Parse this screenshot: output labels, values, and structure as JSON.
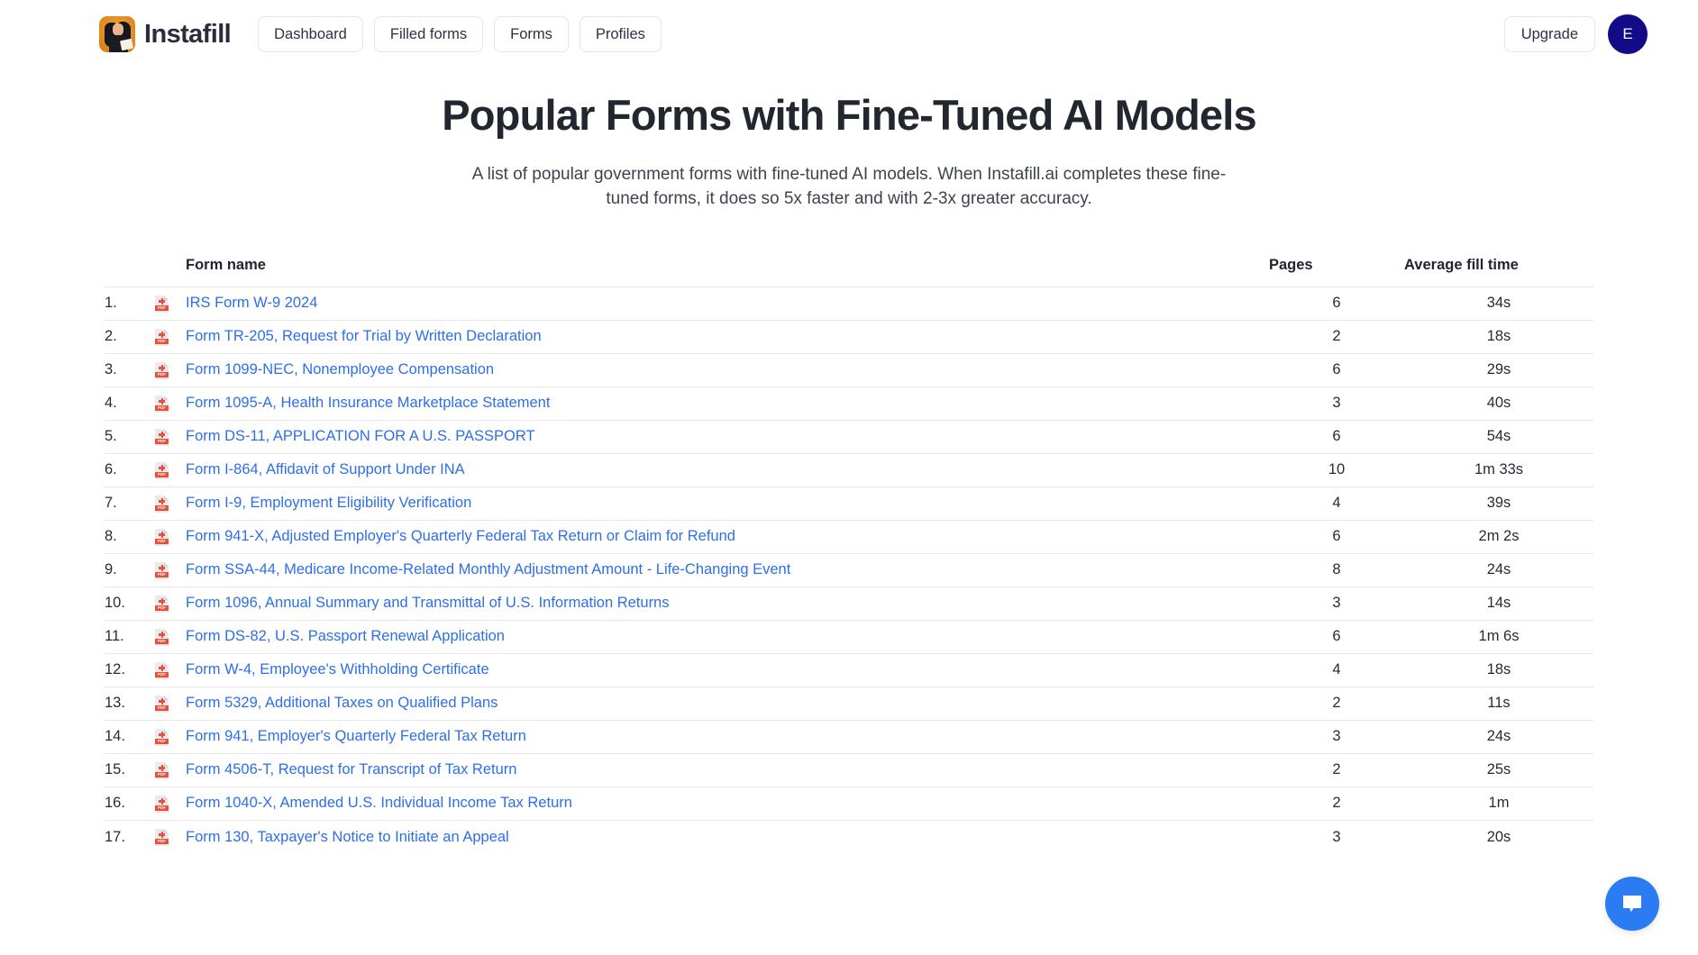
{
  "header": {
    "brand_name": "Instafill",
    "brand_logo_icon": "instafill-avatar-logo",
    "nav": [
      {
        "label": "Dashboard",
        "name": "nav-dashboard"
      },
      {
        "label": "Filled forms",
        "name": "nav-filled-forms"
      },
      {
        "label": "Forms",
        "name": "nav-forms"
      },
      {
        "label": "Profiles",
        "name": "nav-profiles"
      }
    ],
    "upgrade_label": "Upgrade",
    "avatar_initial": "E",
    "avatar_color": "#120a86"
  },
  "main": {
    "title": "Popular Forms with Fine-Tuned AI Models",
    "subtitle": "A list of popular government forms with fine-tuned AI models. When Instafill.ai completes these fine-tuned forms, it does so 5x faster and with 2-3x greater accuracy."
  },
  "table": {
    "columns": {
      "index": "",
      "name": "Form name",
      "pages": "Pages",
      "time": "Average fill time"
    },
    "rows": [
      {
        "index": "1.",
        "icon": "pdf-file-icon",
        "name": "IRS Form W-9 2024",
        "pages": "6",
        "time": "34s"
      },
      {
        "index": "2.",
        "icon": "pdf-file-icon",
        "name": "Form TR-205, Request for Trial by Written Declaration",
        "pages": "2",
        "time": "18s"
      },
      {
        "index": "3.",
        "icon": "pdf-file-icon",
        "name": "Form 1099-NEC, Nonemployee Compensation",
        "pages": "6",
        "time": "29s"
      },
      {
        "index": "4.",
        "icon": "pdf-file-icon",
        "name": "Form 1095-A, Health Insurance Marketplace Statement",
        "pages": "3",
        "time": "40s"
      },
      {
        "index": "5.",
        "icon": "pdf-file-icon",
        "name": "Form DS-11, APPLICATION FOR A U.S. PASSPORT",
        "pages": "6",
        "time": "54s"
      },
      {
        "index": "6.",
        "icon": "pdf-file-icon",
        "name": "Form I-864, Affidavit of Support Under INA",
        "pages": "10",
        "time": "1m 33s"
      },
      {
        "index": "7.",
        "icon": "pdf-file-icon",
        "name": "Form I-9, Employment Eligibility Verification",
        "pages": "4",
        "time": "39s"
      },
      {
        "index": "8.",
        "icon": "pdf-file-icon",
        "name": "Form 941-X, Adjusted Employer's Quarterly Federal Tax Return or Claim for Refund",
        "pages": "6",
        "time": "2m 2s"
      },
      {
        "index": "9.",
        "icon": "pdf-file-icon",
        "name": "Form SSA-44, Medicare Income-Related Monthly Adjustment Amount - Life-Changing Event",
        "pages": "8",
        "time": "24s"
      },
      {
        "index": "10.",
        "icon": "pdf-file-icon",
        "name": "Form 1096, Annual Summary and Transmittal of U.S. Information Returns",
        "pages": "3",
        "time": "14s"
      },
      {
        "index": "11.",
        "icon": "pdf-file-icon",
        "name": "Form DS-82, U.S. Passport Renewal Application",
        "pages": "6",
        "time": "1m 6s"
      },
      {
        "index": "12.",
        "icon": "pdf-file-icon",
        "name": "Form W-4, Employee's Withholding Certificate",
        "pages": "4",
        "time": "18s"
      },
      {
        "index": "13.",
        "icon": "pdf-file-icon",
        "name": "Form 5329, Additional Taxes on Qualified Plans",
        "pages": "2",
        "time": "11s"
      },
      {
        "index": "14.",
        "icon": "pdf-file-icon",
        "name": "Form 941, Employer's Quarterly Federal Tax Return",
        "pages": "3",
        "time": "24s"
      },
      {
        "index": "15.",
        "icon": "pdf-file-icon",
        "name": "Form 4506-T, Request for Transcript of Tax Return",
        "pages": "2",
        "time": "25s"
      },
      {
        "index": "16.",
        "icon": "pdf-file-icon",
        "name": "Form 1040-X, Amended U.S. Individual Income Tax Return",
        "pages": "2",
        "time": "1m"
      },
      {
        "index": "17.",
        "icon": "pdf-file-icon",
        "name": "Form 130, Taxpayer's Notice to Initiate an Appeal",
        "pages": "3",
        "time": "20s"
      }
    ]
  },
  "chat": {
    "icon": "chat-bubble-icon",
    "color": "#2b7bf3"
  },
  "pdf_badge_text": "PDF"
}
